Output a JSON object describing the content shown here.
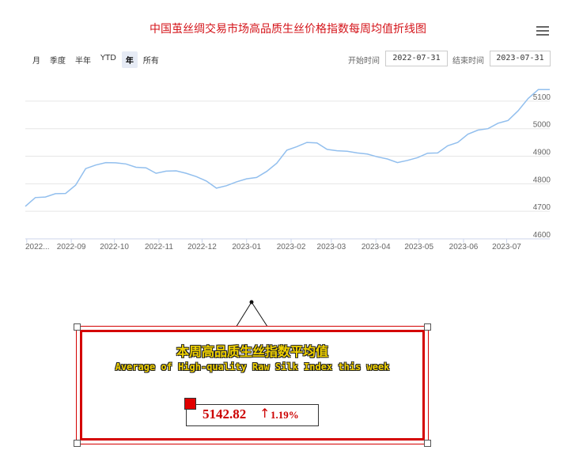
{
  "title": "中国茧丝绸交易市场高品质生丝价格指数每周均值折线图",
  "range_selector": [
    {
      "label": "月",
      "active": false
    },
    {
      "label": "季度",
      "active": false
    },
    {
      "label": "半年",
      "active": false
    },
    {
      "label": "YTD",
      "active": false
    },
    {
      "label": "年",
      "active": true
    },
    {
      "label": "所有",
      "active": false
    }
  ],
  "date_range": {
    "start_label": "开始时间",
    "start_value": "2022-07-31",
    "end_label": "结束时间",
    "end_value": "2023-07-31"
  },
  "colors": {
    "line": "#92bfee",
    "title": "#d4151b",
    "accent_red": "#d40000",
    "gold": "#f2d200"
  },
  "chart_data": {
    "type": "line",
    "title": "中国茧丝绸交易市场高品质生丝价格指数每周均值折线图",
    "xlabel": "",
    "ylabel": "",
    "x_ticks": [
      "2022...",
      "2022-09",
      "2022-10",
      "2022-11",
      "2022-12",
      "2023-01",
      "2023-02",
      "2023-03",
      "2023-04",
      "2023-05",
      "2023-06",
      "2023-07"
    ],
    "x_tick_dates": [
      "2022-08-01",
      "2022-09-01",
      "2022-10-01",
      "2022-11-01",
      "2022-12-01",
      "2023-01-01",
      "2023-02-01",
      "2023-03-01",
      "2023-04-01",
      "2023-05-01",
      "2023-06-01",
      "2023-07-01"
    ],
    "y_ticks": [
      4600,
      4700,
      4800,
      4900,
      5000,
      5100
    ],
    "ylim": [
      4600,
      5140
    ],
    "xlim": [
      "2022-07-31",
      "2023-07-31"
    ],
    "grid": true,
    "series": [
      {
        "x": [
          "2022-07-31",
          "2022-08-07",
          "2022-08-14",
          "2022-08-21",
          "2022-08-28",
          "2022-09-04",
          "2022-09-11",
          "2022-09-18",
          "2022-09-25",
          "2022-10-02",
          "2022-10-09",
          "2022-10-16",
          "2022-10-23",
          "2022-10-30",
          "2022-11-06",
          "2022-11-13",
          "2022-11-20",
          "2022-11-27",
          "2022-12-04",
          "2022-12-11",
          "2022-12-18",
          "2022-12-25",
          "2023-01-01",
          "2023-01-08",
          "2023-01-15",
          "2023-01-22",
          "2023-01-29",
          "2023-02-05",
          "2023-02-12",
          "2023-02-19",
          "2023-02-26",
          "2023-03-05",
          "2023-03-12",
          "2023-03-19",
          "2023-03-26",
          "2023-04-02",
          "2023-04-09",
          "2023-04-16",
          "2023-04-23",
          "2023-04-30",
          "2023-05-07",
          "2023-05-14",
          "2023-05-21",
          "2023-05-28",
          "2023-06-04",
          "2023-06-11",
          "2023-06-18",
          "2023-06-25",
          "2023-07-02",
          "2023-07-09",
          "2023-07-16",
          "2023-07-23",
          "2023-07-31"
        ],
        "y": [
          4718,
          4750,
          4752,
          4764,
          4765,
          4795,
          4855,
          4868,
          4877,
          4876,
          4872,
          4860,
          4858,
          4838,
          4846,
          4847,
          4838,
          4826,
          4810,
          4784,
          4793,
          4807,
          4818,
          4823,
          4845,
          4875,
          4922,
          4935,
          4950,
          4948,
          4925,
          4920,
          4918,
          4912,
          4908,
          4898,
          4890,
          4877,
          4885,
          4895,
          4911,
          4912,
          4938,
          4950,
          4980,
          4995,
          5000,
          5020,
          5030,
          5065,
          5110,
          5142,
          5142
        ]
      }
    ]
  },
  "callout": {
    "title_cn": "本周高品质生丝指数平均值",
    "title_en": "Average of High-quality Raw Silk Index this week",
    "value": "5142.82",
    "arrow": "↑",
    "change": "1.19%"
  }
}
